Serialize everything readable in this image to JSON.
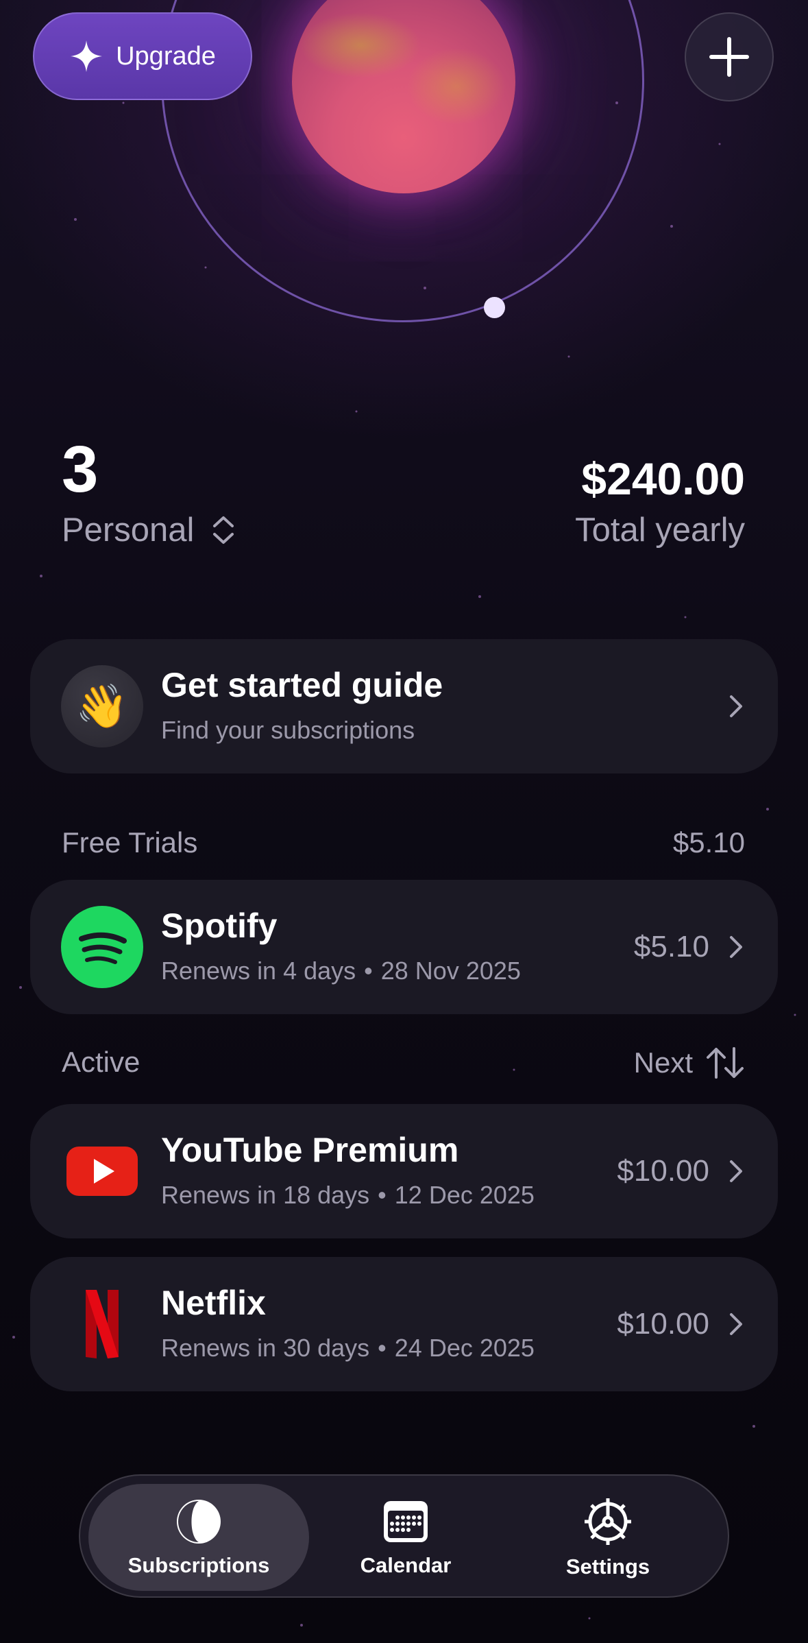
{
  "header": {
    "upgrade_label": "Upgrade"
  },
  "summary": {
    "count": "3",
    "profile": "Personal",
    "total_amount": "$240.00",
    "total_label": "Total yearly"
  },
  "guide": {
    "title": "Get started guide",
    "subtitle": "Find your subscriptions"
  },
  "free_trials": {
    "heading": "Free Trials",
    "total": "$5.10",
    "items": [
      {
        "name": "Spotify",
        "renews": "Renews in 4 days",
        "date": "28 Nov 2025",
        "price": "$5.10",
        "color": "#1ed760"
      }
    ]
  },
  "active": {
    "heading": "Active",
    "sort_label": "Next",
    "items": [
      {
        "name": "YouTube Premium",
        "renews": "Renews in 18 days",
        "date": "12 Dec 2025",
        "price": "$10.00",
        "color": "#e62117"
      },
      {
        "name": "Netflix",
        "renews": "Renews in 30 days",
        "date": "24 Dec 2025",
        "price": "$10.00",
        "color": "#d81f26"
      }
    ]
  },
  "nav": {
    "items": [
      {
        "label": "Subscriptions",
        "icon": "subscriptions-icon",
        "active": true
      },
      {
        "label": "Calendar",
        "icon": "calendar-icon",
        "active": false
      },
      {
        "label": "Settings",
        "icon": "settings-gear-icon",
        "active": false
      }
    ]
  },
  "colors": {
    "background": "#0c0913",
    "card": "#1b1924",
    "accent": "#6e45c0",
    "muted_text": "#a8a5b6"
  }
}
